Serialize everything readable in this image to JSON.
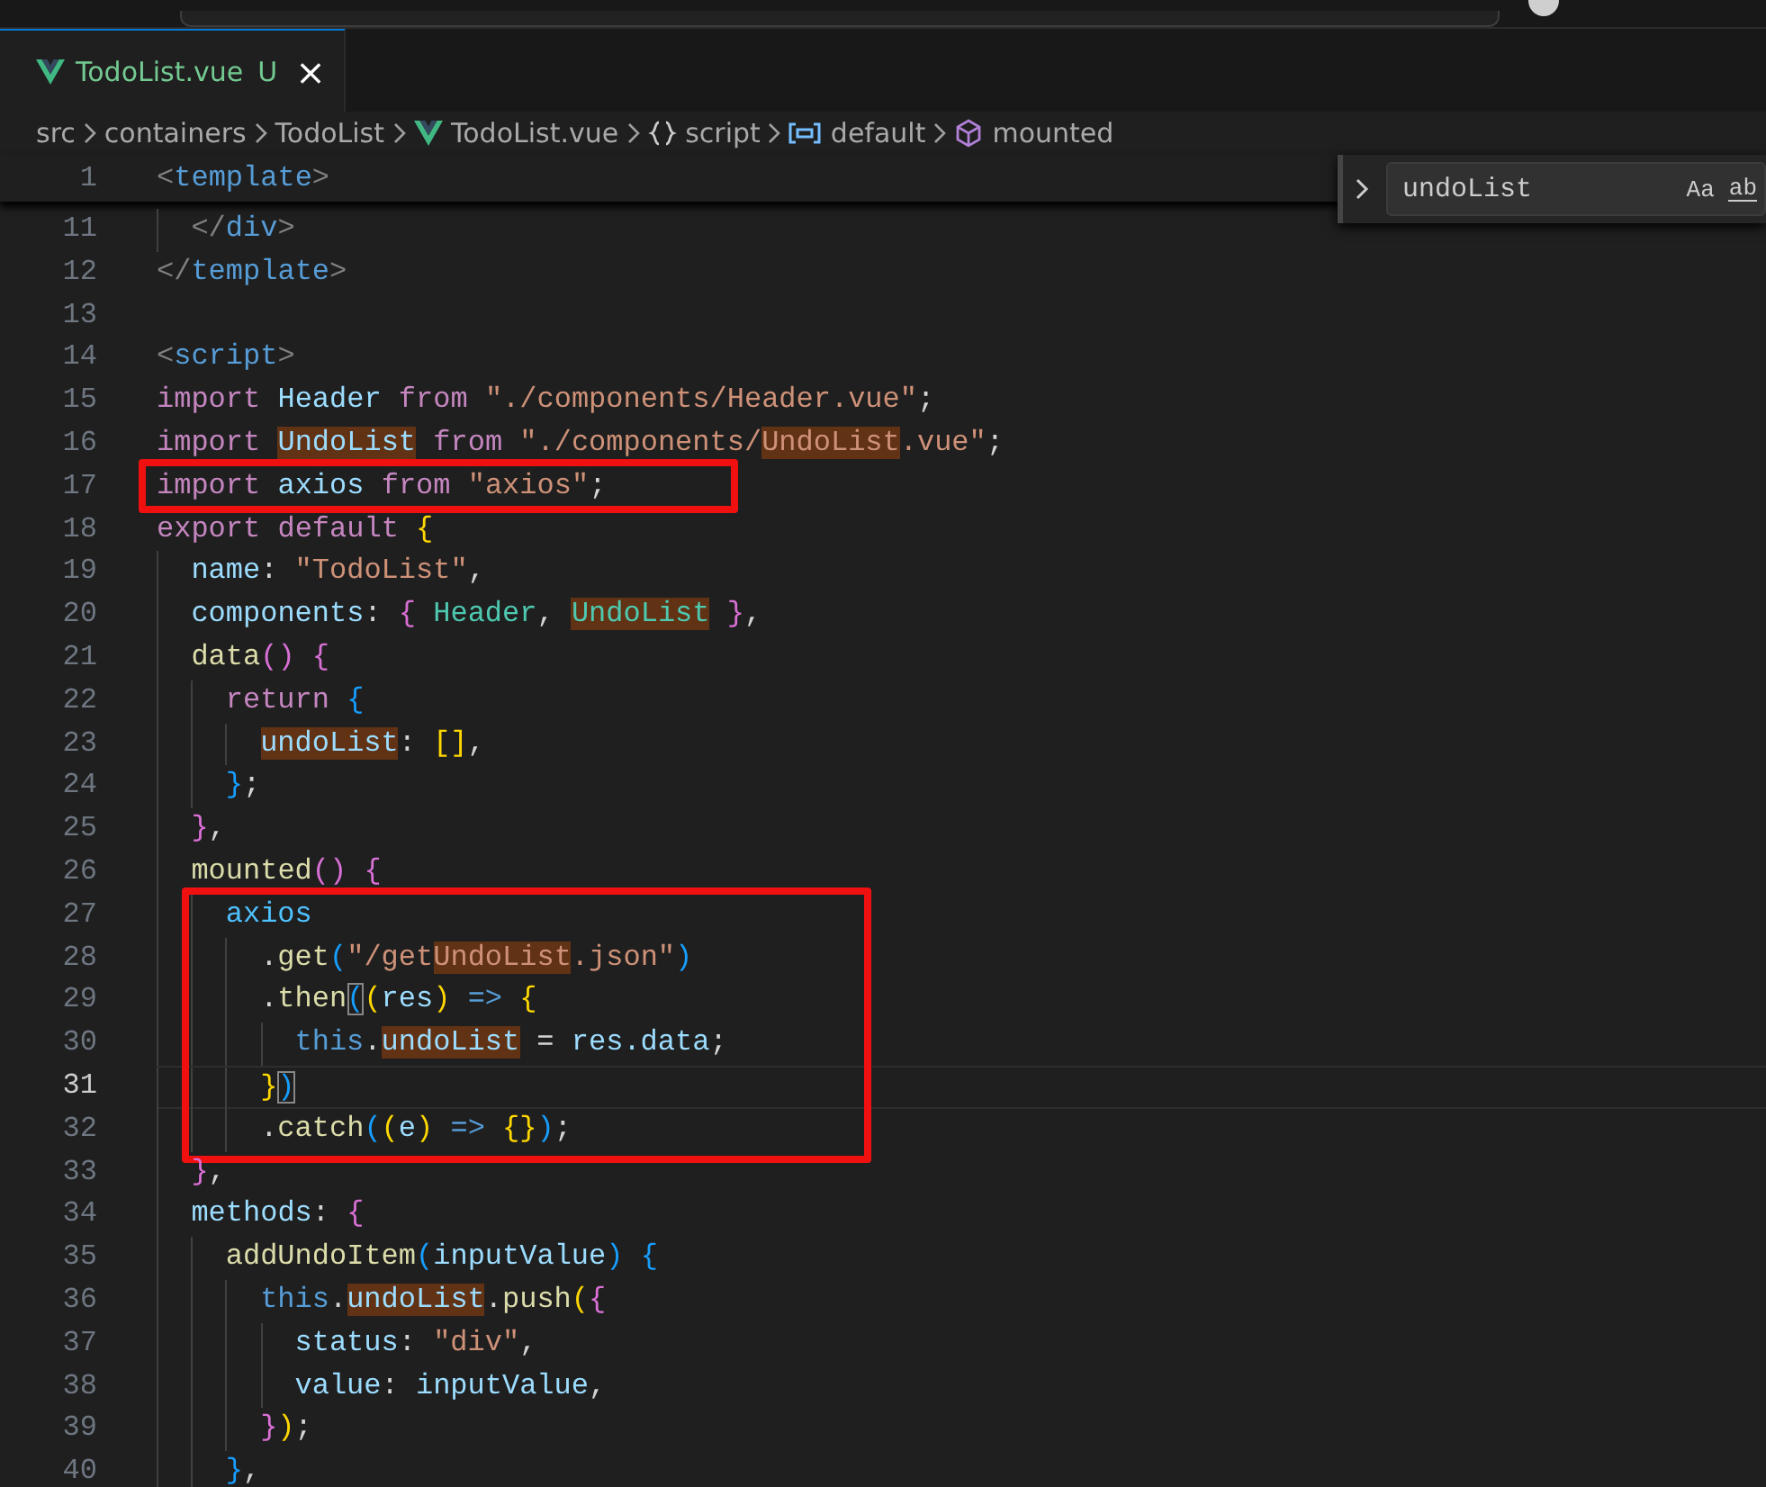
{
  "tabs": [
    {
      "label": "TodoList.vue",
      "badge": "U",
      "close": "×",
      "selected": true
    }
  ],
  "breadcrumbs": [
    {
      "label": "src",
      "kind": "folder"
    },
    {
      "label": "containers",
      "kind": "folder"
    },
    {
      "label": "TodoList",
      "kind": "folder"
    },
    {
      "label": "TodoList.vue",
      "kind": "vue-file"
    },
    {
      "label": "script",
      "kind": "namespace"
    },
    {
      "label": "default",
      "kind": "variable"
    },
    {
      "label": "mounted",
      "kind": "method"
    }
  ],
  "find_widget": {
    "value": "undoList",
    "options": [
      "Aa",
      "ab"
    ]
  },
  "sticky_line": {
    "number": "1",
    "tokens": [
      {
        "text": "<",
        "kind": "punct-tag"
      },
      {
        "text": "template",
        "kind": "tag"
      },
      {
        "text": ">",
        "kind": "punct-tag"
      }
    ]
  },
  "blocks": [
    {
      "boxed": false,
      "lines": [
        {
          "number": "11",
          "current": false,
          "tokens": [
            {
              "text": "  </",
              "kind": "punct-tag"
            },
            {
              "text": "div",
              "kind": "tag"
            },
            {
              "text": ">",
              "kind": "punct-tag"
            }
          ]
        },
        {
          "number": "12",
          "current": false,
          "tokens": [
            {
              "text": "</",
              "kind": "punct-tag"
            },
            {
              "text": "template",
              "kind": "tag"
            },
            {
              "text": ">",
              "kind": "punct-tag"
            }
          ]
        },
        {
          "number": "13",
          "current": false
        },
        {
          "number": "14",
          "current": false,
          "tokens": [
            {
              "text": "<",
              "kind": "punct-tag"
            },
            {
              "text": "script",
              "kind": "tag"
            },
            {
              "text": ">",
              "kind": "punct-tag"
            }
          ]
        },
        {
          "number": "15",
          "current": false,
          "tokens": [
            {
              "text": "import ",
              "kind": "kw"
            },
            {
              "text": "Header",
              "kind": "var"
            },
            {
              "text": " from ",
              "kind": "kw"
            },
            {
              "text": "\"./components/Header.vue\"",
              "kind": "str"
            },
            {
              "text": ";",
              "kind": "plain"
            }
          ]
        },
        {
          "number": "16",
          "current": false,
          "tokens": [
            {
              "text": "import ",
              "kind": "kw"
            },
            {
              "text": "UndoList",
              "kind": "var",
              "match": true
            },
            {
              "text": " from ",
              "kind": "kw"
            },
            {
              "text": "\"./components/",
              "kind": "str"
            },
            {
              "text": "UndoList",
              "kind": "str",
              "match": true
            },
            {
              "text": ".vue\"",
              "kind": "str"
            },
            {
              "text": ";",
              "kind": "plain"
            }
          ]
        }
      ]
    },
    {
      "boxed": true,
      "lines": [
        {
          "number": "17",
          "current": false,
          "tokens": [
            {
              "text": "import ",
              "kind": "kw"
            },
            {
              "text": "axios",
              "kind": "var"
            },
            {
              "text": " from ",
              "kind": "kw"
            },
            {
              "text": "\"axios\"",
              "kind": "str"
            },
            {
              "text": ";",
              "kind": "plain"
            }
          ]
        }
      ]
    },
    {
      "boxed": false,
      "lines": [
        {
          "number": "18",
          "current": false,
          "tokens": [
            {
              "text": "export default",
              "kind": "kw"
            },
            {
              "text": " {",
              "kind": "b1"
            }
          ]
        },
        {
          "number": "19",
          "current": false,
          "tokens": [
            {
              "text": "  name",
              "kind": "var"
            },
            {
              "text": ": ",
              "kind": "plain"
            },
            {
              "text": "\"TodoList\"",
              "kind": "str"
            },
            {
              "text": ",",
              "kind": "plain"
            }
          ]
        },
        {
          "number": "20",
          "current": false,
          "tokens": [
            {
              "text": "  components",
              "kind": "var"
            },
            {
              "text": ": ",
              "kind": "plain"
            },
            {
              "text": "{",
              "kind": "b2"
            },
            {
              "text": " Header",
              "kind": "type"
            },
            {
              "text": ", ",
              "kind": "plain"
            },
            {
              "text": "UndoList",
              "kind": "type",
              "match": true
            },
            {
              "text": " }",
              "kind": "b2"
            },
            {
              "text": ",",
              "kind": "plain"
            }
          ]
        },
        {
          "number": "21",
          "current": false,
          "tokens": [
            {
              "text": "  data",
              "kind": "fn"
            },
            {
              "text": "()",
              "kind": "b2"
            },
            {
              "text": " {",
              "kind": "b2"
            }
          ]
        },
        {
          "number": "22",
          "current": false,
          "tokens": [
            {
              "text": "    return",
              "kind": "kw"
            },
            {
              "text": " {",
              "kind": "b3"
            }
          ]
        },
        {
          "number": "23",
          "current": false,
          "tokens": [
            {
              "text": "      undoList",
              "kind": "var",
              "match": true
            },
            {
              "text": ": ",
              "kind": "plain"
            },
            {
              "text": "[]",
              "kind": "b1"
            },
            {
              "text": ",",
              "kind": "plain"
            }
          ]
        },
        {
          "number": "24",
          "current": false,
          "tokens": [
            {
              "text": "    }",
              "kind": "b3"
            },
            {
              "text": ";",
              "kind": "plain"
            }
          ]
        },
        {
          "number": "25",
          "current": false,
          "tokens": [
            {
              "text": "  }",
              "kind": "b2"
            },
            {
              "text": ",",
              "kind": "plain"
            }
          ]
        },
        {
          "number": "26",
          "current": false,
          "tokens": [
            {
              "text": "  mounted",
              "kind": "fn"
            },
            {
              "text": "()",
              "kind": "b2"
            },
            {
              "text": " {",
              "kind": "b2"
            }
          ]
        }
      ]
    },
    {
      "boxed": true,
      "lines": [
        {
          "number": "27",
          "current": false,
          "tokens": [
            {
              "text": "    axios",
              "kind": "var2"
            }
          ]
        },
        {
          "number": "28",
          "current": false,
          "tokens": [
            {
              "text": "      .",
              "kind": "plain"
            },
            {
              "text": "get",
              "kind": "fn"
            },
            {
              "text": "(",
              "kind": "b3"
            },
            {
              "text": "\"/get",
              "kind": "str"
            },
            {
              "text": "UndoList",
              "kind": "str",
              "match": true
            },
            {
              "text": ".json\"",
              "kind": "str"
            },
            {
              "text": ")",
              "kind": "b3"
            }
          ]
        },
        {
          "number": "29",
          "current": false,
          "tokens": [
            {
              "text": "      .",
              "kind": "plain"
            },
            {
              "text": "then",
              "kind": "fn"
            },
            {
              "text": "(",
              "kind": "b3",
              "bracket_match": true
            },
            {
              "text": "(",
              "kind": "b1"
            },
            {
              "text": "res",
              "kind": "var"
            },
            {
              "text": ")",
              "kind": "b1"
            },
            {
              "text": " =>",
              "kind": "storage"
            },
            {
              "text": " {",
              "kind": "b1"
            }
          ]
        },
        {
          "number": "30",
          "current": false,
          "tokens": [
            {
              "text": "        this",
              "kind": "storage"
            },
            {
              "text": ".",
              "kind": "plain"
            },
            {
              "text": "undoList",
              "kind": "var",
              "match": true
            },
            {
              "text": " = ",
              "kind": "plain"
            },
            {
              "text": "res.data",
              "kind": "var"
            },
            {
              "text": ";",
              "kind": "plain"
            }
          ]
        },
        {
          "number": "31",
          "current": true,
          "tokens": [
            {
              "text": "      }",
              "kind": "b1"
            },
            {
              "text": ")",
              "kind": "b3",
              "bracket_match": true
            }
          ]
        },
        {
          "number": "32",
          "current": false,
          "tokens": [
            {
              "text": "      .",
              "kind": "plain"
            },
            {
              "text": "catch",
              "kind": "fn"
            },
            {
              "text": "(",
              "kind": "b3"
            },
            {
              "text": "(",
              "kind": "b1"
            },
            {
              "text": "e",
              "kind": "var"
            },
            {
              "text": ")",
              "kind": "b1"
            },
            {
              "text": " =>",
              "kind": "storage"
            },
            {
              "text": " {}",
              "kind": "b1"
            },
            {
              "text": ")",
              "kind": "b3"
            },
            {
              "text": ";",
              "kind": "plain"
            }
          ]
        }
      ]
    },
    {
      "boxed": false,
      "lines": [
        {
          "number": "33",
          "current": false,
          "tokens": [
            {
              "text": "  }",
              "kind": "b2"
            },
            {
              "text": ",",
              "kind": "plain"
            }
          ]
        },
        {
          "number": "34",
          "current": false,
          "tokens": [
            {
              "text": "  methods",
              "kind": "var"
            },
            {
              "text": ": ",
              "kind": "plain"
            },
            {
              "text": "{",
              "kind": "b2"
            }
          ]
        },
        {
          "number": "35",
          "current": false,
          "tokens": [
            {
              "text": "    addUndoItem",
              "kind": "fn"
            },
            {
              "text": "(",
              "kind": "b3"
            },
            {
              "text": "inputValue",
              "kind": "var"
            },
            {
              "text": ")",
              "kind": "b3"
            },
            {
              "text": " {",
              "kind": "b3"
            }
          ]
        },
        {
          "number": "36",
          "current": false,
          "tokens": [
            {
              "text": "      this",
              "kind": "storage"
            },
            {
              "text": ".",
              "kind": "plain"
            },
            {
              "text": "undoList",
              "kind": "var",
              "match": true
            },
            {
              "text": ".",
              "kind": "plain"
            },
            {
              "text": "push",
              "kind": "fn"
            },
            {
              "text": "(",
              "kind": "b1"
            },
            {
              "text": "{",
              "kind": "b2"
            }
          ]
        },
        {
          "number": "37",
          "current": false,
          "tokens": [
            {
              "text": "        status",
              "kind": "var"
            },
            {
              "text": ": ",
              "kind": "plain"
            },
            {
              "text": "\"div\"",
              "kind": "str"
            },
            {
              "text": ",",
              "kind": "plain"
            }
          ]
        },
        {
          "number": "38",
          "current": false,
          "tokens": [
            {
              "text": "        value",
              "kind": "var"
            },
            {
              "text": ": ",
              "kind": "plain"
            },
            {
              "text": "inputValue",
              "kind": "var"
            },
            {
              "text": ",",
              "kind": "plain"
            }
          ]
        },
        {
          "number": "39",
          "current": false,
          "tokens": [
            {
              "text": "      }",
              "kind": "b2"
            },
            {
              "text": ")",
              "kind": "b1"
            },
            {
              "text": ";",
              "kind": "plain"
            }
          ]
        },
        {
          "number": "40",
          "current": false,
          "tokens": [
            {
              "text": "    }",
              "kind": "b3"
            },
            {
              "text": ",",
              "kind": "plain"
            }
          ]
        }
      ]
    }
  ]
}
